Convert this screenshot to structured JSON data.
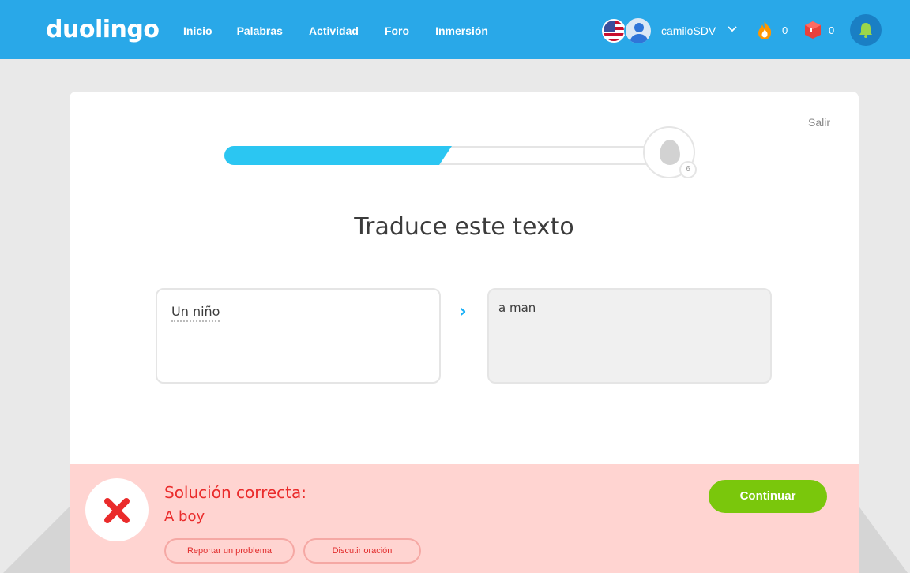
{
  "header": {
    "logo": "duolingo",
    "nav": [
      "Inicio",
      "Palabras",
      "Actividad",
      "Foro",
      "Inmersión"
    ],
    "username": "camiloSDV",
    "chevron_icon": "chevron-down-icon",
    "streak_count": "0",
    "gems_count": "0"
  },
  "lesson": {
    "exit_label": "Salir",
    "progress_fraction": 0.49,
    "egg_count": "6",
    "prompt": "Traduce este texto",
    "source_text": "Un niño",
    "arrow_glyph": "›",
    "user_answer": "a man"
  },
  "feedback": {
    "title": "Solución correcta:",
    "correct_answer": "A boy",
    "report_label": "Reportar un problema",
    "discuss_label": "Discutir oración",
    "continue_label": "Continuar"
  },
  "colors": {
    "brand_blue": "#29a8e8",
    "error_red": "#ea2b2b",
    "success_green": "#7ac70c",
    "feedback_bg": "#ffd4d1"
  }
}
